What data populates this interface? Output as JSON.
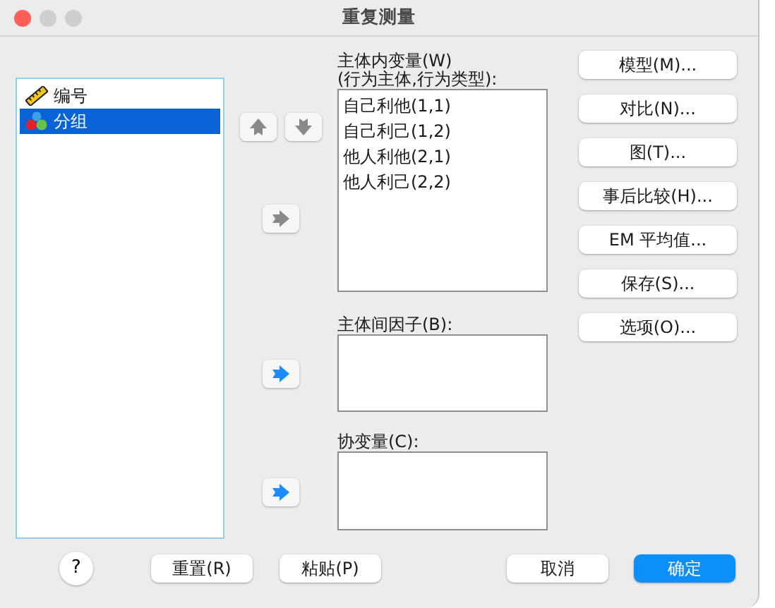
{
  "window": {
    "title": "重复测量"
  },
  "source_variables": [
    {
      "name": "编号",
      "kind": "scale",
      "selected": false
    },
    {
      "name": "分组",
      "kind": "nominal",
      "selected": true
    }
  ],
  "reorder_buttons": [
    {
      "kind": "up",
      "disabled": true
    },
    {
      "kind": "down",
      "disabled": true
    }
  ],
  "targets": [
    {
      "label": "主体内变量(W)",
      "sublabel": "(行为主体,行为类型):",
      "move_disabled": true,
      "items": [
        "自己利他(1,1)",
        "自己利己(1,2)",
        "他人利他(2,1)",
        "他人利己(2,2)"
      ]
    },
    {
      "label": "主体间因子(B):",
      "move_disabled": false
    },
    {
      "label": "协变量(C):",
      "move_disabled": false
    }
  ],
  "side_buttons": [
    "模型(M)...",
    "对比(N)...",
    "图(T)...",
    "事后比较(H)...",
    "EM 平均值...",
    "保存(S)...",
    "选项(O)..."
  ],
  "help_button": "?",
  "bottom_buttons": [
    {
      "label": "重置(R)",
      "kind": "normal"
    },
    {
      "label": "粘贴(P)",
      "kind": "normal"
    },
    {
      "label": "取消",
      "kind": "normal"
    },
    {
      "label": "确定",
      "kind": "default"
    }
  ]
}
